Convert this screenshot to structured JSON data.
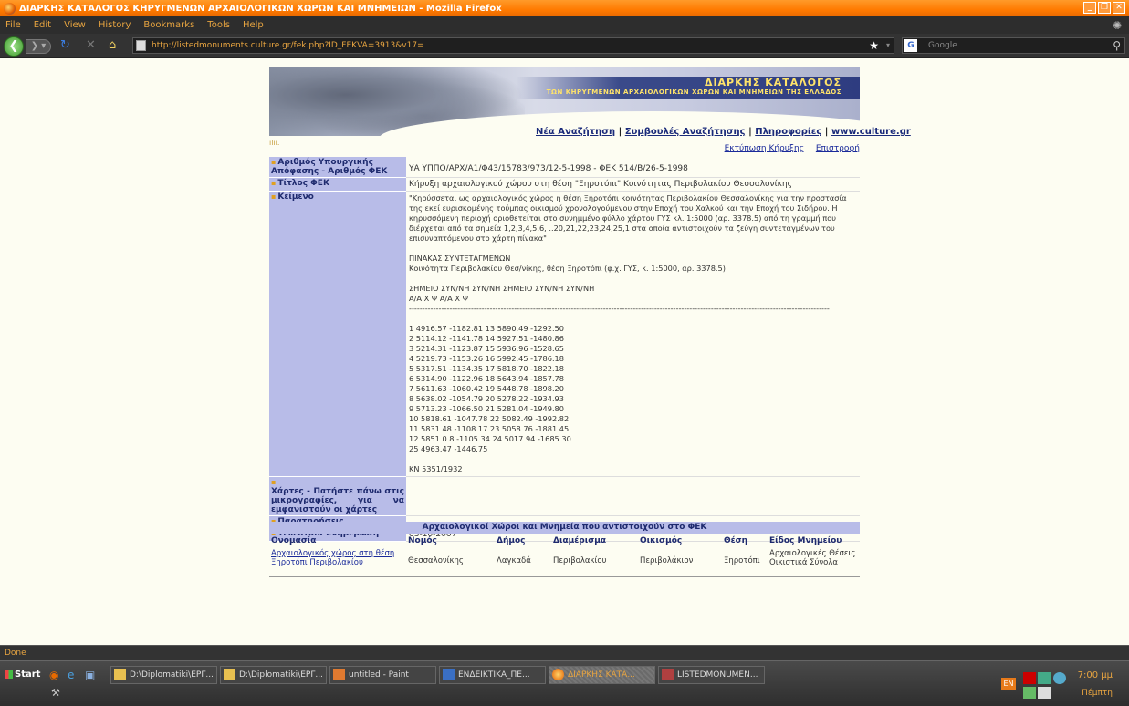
{
  "window": {
    "title": "ΔΙΑΡΚΗΣ ΚΑΤΑΛΟΓΟΣ ΚΗΡΥΓΜΕΝΩΝ ΑΡΧΑΙΟΛΟΓΙΚΩΝ ΧΩΡΩΝ ΚΑΙ ΜΝΗΜΕΙΩΝ - Mozilla Firefox"
  },
  "menu": [
    "File",
    "Edit",
    "View",
    "History",
    "Bookmarks",
    "Tools",
    "Help"
  ],
  "nav": {
    "url": "http://listedmonuments.culture.gr/fek.php?ID_FEKVA=3913&v17=",
    "search_placeholder": "Google"
  },
  "banner": {
    "title": "ΔΙΑΡΚΗΣ ΚΑΤΑΛΟΓΟΣ",
    "subtitle": "ΤΩΝ ΚΗΡΥΓΜΕΝΩΝ ΑΡΧΑΙΟΛΟΓΙΚΩΝ ΧΩΡΩΝ ΚΑΙ ΜΝΗΜΕΙΩΝ ΤΗΣ ΕΛΛΑΔΟΣ"
  },
  "toplinks": [
    "Νέα Αναζήτηση",
    "Συμβουλές Αναζήτησης",
    "Πληροφορίες",
    "www.culture.gr"
  ],
  "sublinks": [
    "Εκτύπωση Κήρυξης",
    "Επιστροφή"
  ],
  "fields": {
    "decision_label": "Αριθμός Υπουργικής Απόφασης - Αριθμός ΦΕΚ",
    "decision_value": "ΥΑ ΥΠΠΟ/ΑΡΧ/Α1/Φ43/15783/973/12-5-1998 - ΦΕΚ 514/Β/26-5-1998",
    "title_label": "Τίτλος ΦΕΚ",
    "title_value": "Κήρυξη αρχαιολογικού χώρου στη θέση \"Ξηροτόπι\" Κοινότητας Περιβολακίου Θεσσαλονίκης",
    "text_label": "Κείμενο",
    "text_value": "\"Κηρύσσεται ως αρχαιολογικός χώρος η θέση Ξηροτόπι κοινότητας Περιβολακίου Θεσσαλονίκης για την προστασία της εκεί ευρισκομένης τούμπας οικισμού χρονολογούμενου στην Εποχή του Χαλκού και την Εποχή του Σιδήρου. Η κηρυσσόμενη περιοχή οριοθετείται στο συνημμένο φύλλο χάρτου ΓΥΣ κλ. 1:5000 (αρ. 3378.5) από τη γραμμή που διέρχεται από τα σημεία 1,2,3,4,5,6, ..20,21,22,23,24,25,1 στα οποία αντιστοιχούν τα ζεύγη συντεταγμένων του επισυναπτόμενου στο χάρτη πίνακα\"\n\nΠΙΝΑΚΑΣ ΣΥΝΤΕΤΑΓΜΕΝΩΝ\nΚοινότητα Περιβολακίου Θεσ/νίκης, θέση Ξηροτόπι (φ.χ. ΓΥΣ, κ. 1:5000, αρ. 3378.5)\n\nΣΗΜΕΙΟ ΣΥΝ/ΝΗ ΣΥΝ/ΝΗ ΣΗΜΕΙΟ ΣΥΝ/ΝΗ ΣΥΝ/ΝΗ\nΑ/Α Χ Ψ Α/Α Χ Ψ\n------------------------------------------------------------------------------------------------------------------------------------------------------------\n\n1 4916.57 -1182.81 13 5890.49 -1292.50\n2 5114.12 -1141.78 14 5927.51 -1480.86\n3 5214.31 -1123.87 15 5936.96 -1528.65\n4 5219.73 -1153.26 16 5992.45 -1786.18\n5 5317.51 -1134.35 17 5818.70 -1822.18\n6 5314.90 -1122.96 18 5643.94 -1857.78\n7 5611.63 -1060.42 19 5448.78 -1898.20\n8 5638.02 -1054.79 20 5278.22 -1934.93\n9 5713.23 -1066.50 21 5281.04 -1949.80\n10 5818.61 -1047.78 22 5082.49 -1992.82\n11 5831.48 -1108.17 23 5058.76 -1881.45\n12 5851.0 8 -1105.34 24 5017.94 -1685.30\n25 4963.47 -1446.75\n\nΚΝ 5351/1932",
    "maps_label": "Χάρτες - Πατήστε πάνω στις μικρογραφίες, για να εμφανιστούν οι χάρτες",
    "notes_label": "Παρατηρήσεις",
    "updated_label": "Τελευταία Ενημέρωση",
    "updated_value": "03-10-2007"
  },
  "assoc": {
    "heading": "Αρχαιολογικοί Χώροι και Μνημεία που αντιστοιχούν στο ΦΕΚ",
    "columns": [
      "Ονομασία",
      "Νομός",
      "Δήμος",
      "Διαμέρισμα",
      "Οικισμός",
      "Θέση",
      "Είδος Μνημείου"
    ],
    "row": {
      "name": "Αρχαιολογικός χώρος στη θέση Ξηροτόπι Περιβολακίου",
      "nomos": "Θεσσαλονίκης",
      "dimos": "Λαγκαδά",
      "diamerisma": "Περιβολακίου",
      "oikismos": "Περιβολάκιον",
      "thesi": "Ξηροτόπι",
      "eidos": "Αρχαιολογικές Θέσεις Οικιστικά Σύνολα"
    }
  },
  "status": "Done",
  "taskbar": {
    "start": "Start",
    "tasks": [
      "D:\\Diplomatiki\\ΕΡΓ...",
      "D:\\Diplomatiki\\ΕΡΓ...",
      "untitled - Paint",
      "ΕΝΔΕΙΚΤΙΚΑ_ΠΕ...",
      "ΔΙΑΡΚΗΣ ΚΑΤΑ...",
      "LISTEDMONUMEN..."
    ],
    "lang": "EN",
    "clock": "7:00 μμ",
    "day": "Πέμπτη"
  },
  "colors": {
    "label_bg": "#b8bce8",
    "label_text": "#1e2a6e",
    "accent_orange": "#ff7a00"
  }
}
